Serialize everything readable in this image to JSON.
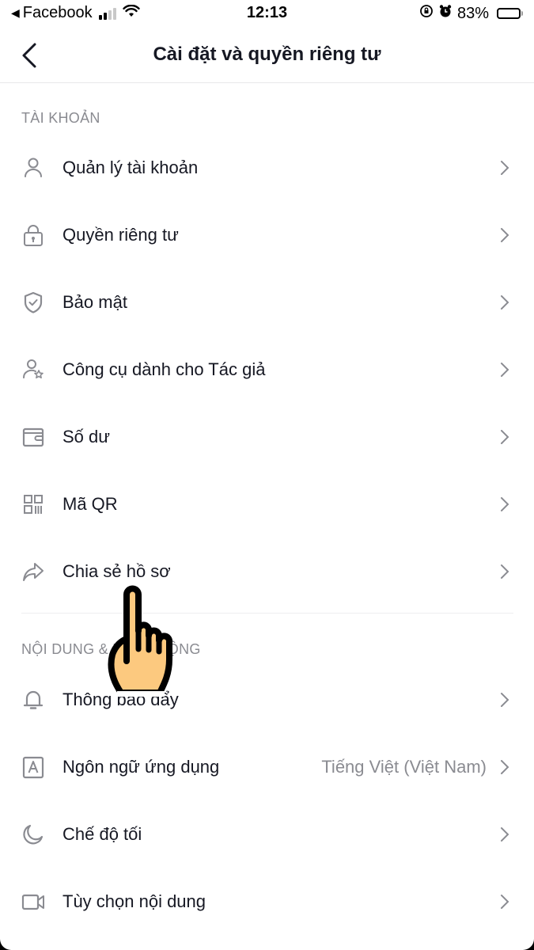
{
  "status_bar": {
    "back_app": "Facebook",
    "time": "12:13",
    "battery_percent_label": "83%",
    "battery_level": 0.83,
    "signal_bars_active": 2,
    "signal_bars_total": 4,
    "icons": [
      "back-to-app-icon",
      "cellular-signal-icon",
      "wifi-icon",
      "rotation-lock-icon",
      "alarm-icon",
      "battery-icon"
    ]
  },
  "nav": {
    "title": "Cài đặt và quyền riêng tư",
    "back_icon": "chevron-left-icon"
  },
  "sections": [
    {
      "header": "TÀI KHOẢN",
      "items": [
        {
          "label": "Quản lý tài khoản",
          "icon": "person-icon"
        },
        {
          "label": "Quyền riêng tư",
          "icon": "lock-icon"
        },
        {
          "label": "Bảo mật",
          "icon": "shield-check-icon"
        },
        {
          "label": "Công cụ dành cho Tác giả",
          "icon": "person-star-icon"
        },
        {
          "label": "Số dư",
          "icon": "wallet-icon"
        },
        {
          "label": "Mã QR",
          "icon": "qr-code-icon"
        },
        {
          "label": "Chia sẻ hồ sơ",
          "icon": "share-arrow-icon"
        }
      ]
    },
    {
      "header": "NỘI DUNG & HOẠT ĐỘNG",
      "items": [
        {
          "label": "Thông báo đẩy",
          "icon": "bell-icon"
        },
        {
          "label": "Ngôn ngữ ứng dụng",
          "icon": "language-a-icon",
          "value": "Tiếng Việt (Việt Nam)"
        },
        {
          "label": "Chế độ tối",
          "icon": "moon-icon"
        },
        {
          "label": "Tùy chọn nội dung",
          "icon": "video-camera-icon"
        }
      ]
    }
  ],
  "colors": {
    "text_primary": "#161823",
    "text_secondary": "#8a8b91",
    "icon": "#8a8b91",
    "hand_fill": "#fcc97f"
  }
}
